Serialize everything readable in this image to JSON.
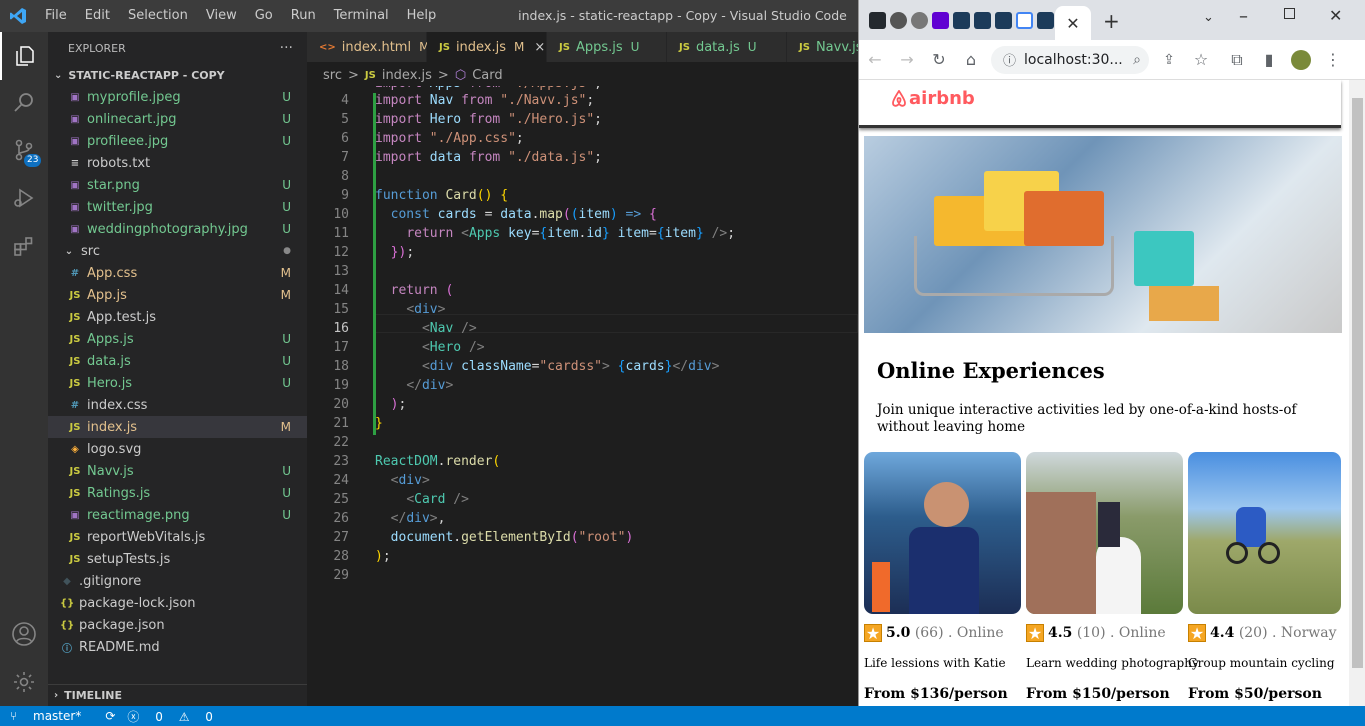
{
  "titlebar": {
    "menu": [
      "File",
      "Edit",
      "Selection",
      "View",
      "Go",
      "Run",
      "Terminal",
      "Help"
    ],
    "window_title": "index.js - static-reactapp - Copy - Visual Studio Code"
  },
  "activity": {
    "scm_badge": "23"
  },
  "sidebar": {
    "header": "EXPLORER",
    "more": "···",
    "folder": "STATIC-REACTAPP - COPY",
    "items": [
      {
        "icon": "image",
        "label": "myprofile.jpeg",
        "status": "U"
      },
      {
        "icon": "image",
        "label": "onlinecart.jpg",
        "status": "U"
      },
      {
        "icon": "image",
        "label": "profileee.jpg",
        "status": "U"
      },
      {
        "icon": "text",
        "label": "robots.txt",
        "status": ""
      },
      {
        "icon": "image",
        "label": "star.png",
        "status": "U"
      },
      {
        "icon": "image",
        "label": "twitter.jpg",
        "status": "U"
      },
      {
        "icon": "image",
        "label": "weddingphotography.jpg",
        "status": "U"
      },
      {
        "icon": "folder",
        "label": "src",
        "status": "●"
      },
      {
        "icon": "css",
        "label": "App.css",
        "status": "M"
      },
      {
        "icon": "js",
        "label": "App.js",
        "status": "M"
      },
      {
        "icon": "js",
        "label": "App.test.js",
        "status": ""
      },
      {
        "icon": "js",
        "label": "Apps.js",
        "status": "U"
      },
      {
        "icon": "js",
        "label": "data.js",
        "status": "U"
      },
      {
        "icon": "js",
        "label": "Hero.js",
        "status": "U"
      },
      {
        "icon": "css",
        "label": "index.css",
        "status": ""
      },
      {
        "icon": "js",
        "label": "index.js",
        "status": "M"
      },
      {
        "icon": "svg",
        "label": "logo.svg",
        "status": ""
      },
      {
        "icon": "js",
        "label": "Navv.js",
        "status": "U"
      },
      {
        "icon": "js",
        "label": "Ratings.js",
        "status": "U"
      },
      {
        "icon": "image",
        "label": "reactimage.png",
        "status": "U"
      },
      {
        "icon": "js",
        "label": "reportWebVitals.js",
        "status": ""
      },
      {
        "icon": "js",
        "label": "setupTests.js",
        "status": ""
      },
      {
        "icon": "git",
        "label": ".gitignore",
        "status": ""
      },
      {
        "icon": "json",
        "label": "package-lock.json",
        "status": ""
      },
      {
        "icon": "json",
        "label": "package.json",
        "status": ""
      },
      {
        "icon": "info",
        "label": "README.md",
        "status": ""
      }
    ],
    "timeline": "TIMELINE"
  },
  "tabs": [
    {
      "icon": "<>",
      "label": "index.html",
      "status": "M"
    },
    {
      "icon": "JS",
      "label": "index.js",
      "status": "M"
    },
    {
      "icon": "JS",
      "label": "Apps.js",
      "status": "U"
    },
    {
      "icon": "JS",
      "label": "data.js",
      "status": "U"
    },
    {
      "icon": "JS",
      "label": "Navv.js",
      "status": ""
    }
  ],
  "breadcrumb": {
    "a": "src",
    "sep": ">",
    "b": "index.js",
    "c": "Card"
  },
  "line_numbers": [
    "4",
    "5",
    "6",
    "7",
    "8",
    "9",
    "10",
    "11",
    "12",
    "13",
    "14",
    "15",
    "16",
    "17",
    "18",
    "19",
    "20",
    "21",
    "22",
    "23",
    "24",
    "25",
    "26",
    "27",
    "28",
    "29"
  ],
  "status": {
    "branch": "master*",
    "errors": "0",
    "warnings": "0"
  },
  "browser": {
    "address": "localhost:30...",
    "logo": "airbnb",
    "heading": "Online Experiences",
    "intro": "Join unique interactive activities led by one-of-a-kind hosts-of without leaving home",
    "cards": [
      {
        "rating": "5.0",
        "count": "(66)",
        "location": ". Online",
        "title": "Life lessions with Katie",
        "price": "From $136/person"
      },
      {
        "rating": "4.5",
        "count": "(10)",
        "location": ". Online",
        "title": "Learn wedding photography",
        "price": "From $150/person"
      },
      {
        "rating": "4.4",
        "count": "(20)",
        "location": ". Norway",
        "title": "Group mountain cycling",
        "price": "From $50/person"
      }
    ]
  }
}
